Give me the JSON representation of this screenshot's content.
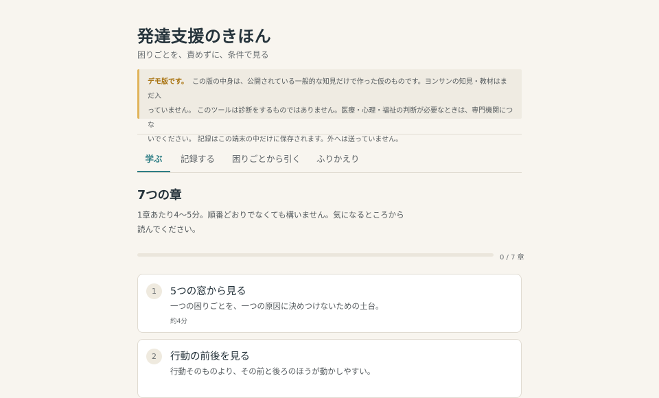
{
  "header": {
    "title": "発達支援のきほん",
    "subtitle": "困りごとを、責めずに、条件で見る"
  },
  "notice": {
    "lead": "デモ版です。",
    "line1": "この版の中身は、公開されている一般的な知見だけで作った仮のものです。ヨンサンの知見・教材はまだ入",
    "line2": "っていません。 このツールは診断をするものではありません。医療・心理・福祉の判断が必要なときは、専門機関につな",
    "line3": "いでください。 記録はこの端末の中だけに保存されます。外へは送っていません。"
  },
  "tabs": [
    {
      "label": "学ぶ",
      "active": true
    },
    {
      "label": "記録する",
      "active": false
    },
    {
      "label": "困りごとから引く",
      "active": false
    },
    {
      "label": "ふりかえり",
      "active": false
    }
  ],
  "section": {
    "title": "7つの章",
    "desc_line1": "1章あたり4〜5分。順番どおりでなくても構いません。気になるところから",
    "desc_line2": "読んでください。"
  },
  "progress": {
    "text": "0 / 7 章",
    "completed": 0,
    "total": 7
  },
  "chapters": [
    {
      "num": "1",
      "title": "5つの窓から見る",
      "desc": "一つの困りごとを、一つの原因に決めつけないための土台。",
      "time": "約4分"
    },
    {
      "num": "2",
      "title": "行動の前後を見る",
      "desc": "行動そのものより、その前と後ろのほうが動かしやすい。",
      "time": ""
    }
  ],
  "colors": {
    "background": "#f8f5ef",
    "accent": "#2e7e85",
    "notice_border": "#e0b35a",
    "notice_lead": "#a8720e"
  }
}
